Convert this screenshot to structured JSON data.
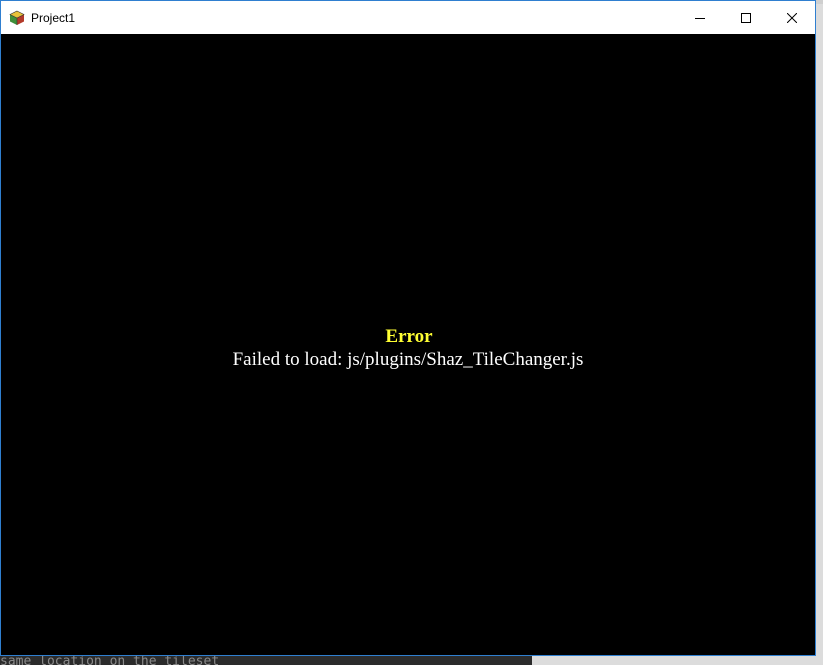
{
  "window": {
    "title": "Project1",
    "accent": "#2f7fd0",
    "icons": {
      "app": "rpg-maker-cube-icon",
      "minimize": "minimize-icon",
      "maximize": "maximize-icon",
      "close": "close-icon"
    }
  },
  "error": {
    "title": "Error",
    "message": "Failed to load: js/plugins/Shaz_TileChanger.js",
    "title_color": "#ffff33",
    "message_color": "#ffffff"
  },
  "background": {
    "bottom_text": "same location on the tileset"
  }
}
